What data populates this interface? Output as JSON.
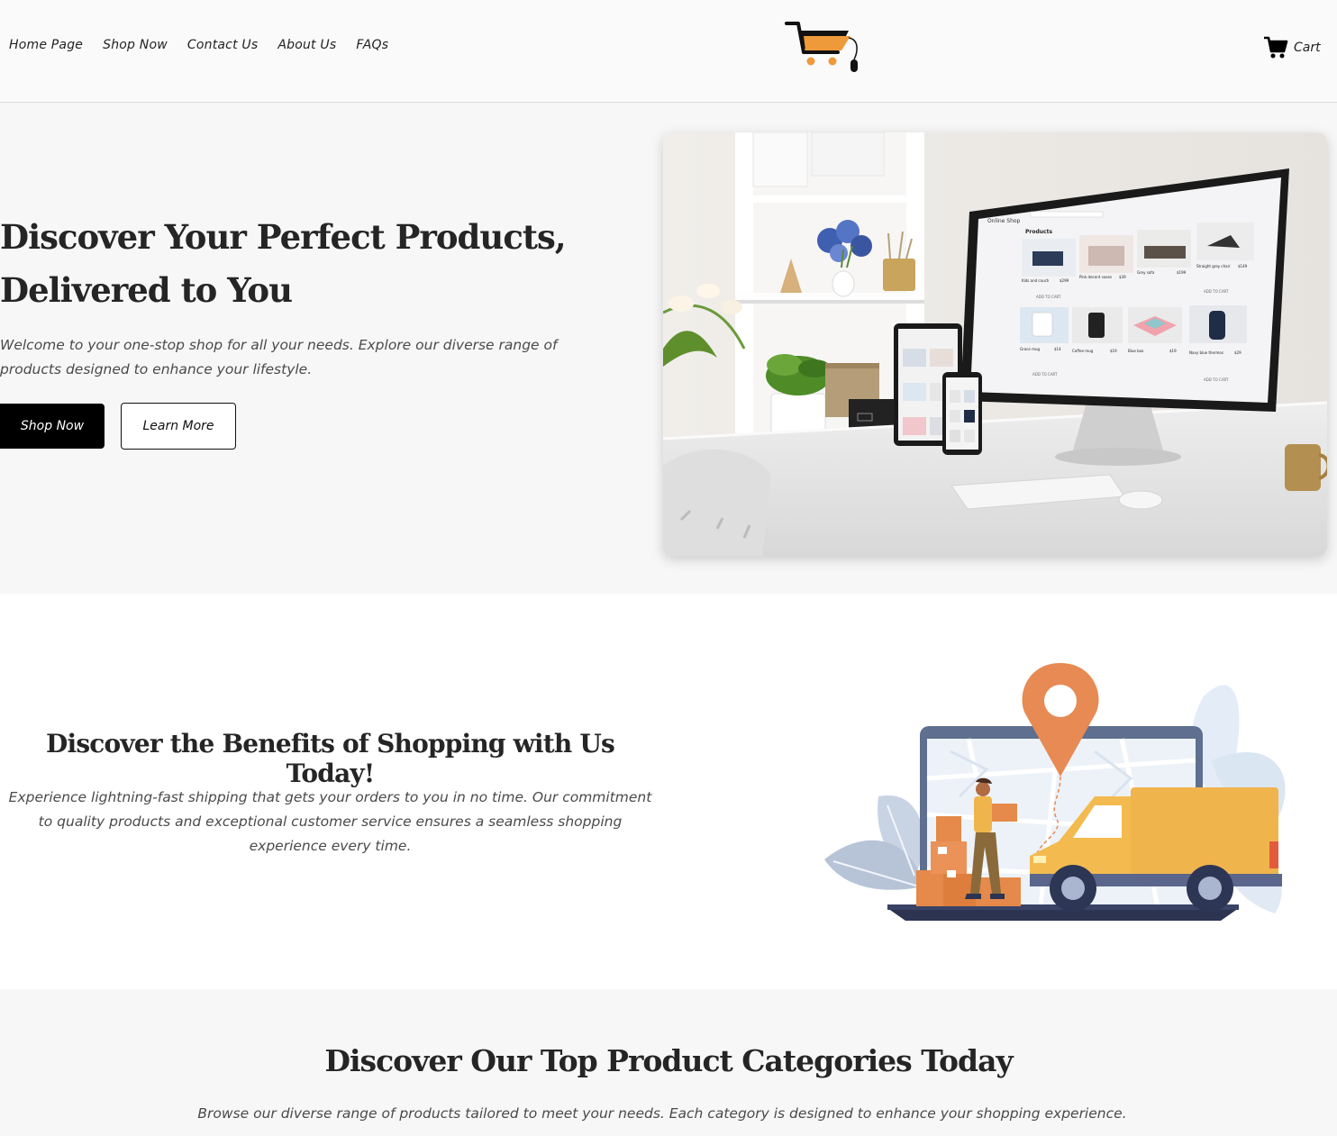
{
  "header": {
    "nav": [
      "Home Page",
      "Shop Now",
      "Contact Us",
      "About Us",
      "FAQs"
    ],
    "cart_label": "Cart",
    "logo_icon": "shopping-cart-mouse-logo",
    "brand_orange": "#ee9a3b"
  },
  "hero": {
    "title": "Discover Your Perfect Products, Delivered to You",
    "subtitle": "Welcome to your one-stop shop for all your needs. Explore our diverse range of products designed to enhance your lifestyle.",
    "primary_button": "Shop Now",
    "secondary_button": "Learn More"
  },
  "hero_screen": {
    "brand": "Online Shop",
    "heading": "Products",
    "products": [
      {
        "name": "Kids and couch",
        "price": "$299"
      },
      {
        "name": "Pink decent vases",
        "price": "$39"
      },
      {
        "name": "Grey sofa",
        "price": "$199"
      },
      {
        "name": "Straight grey chair",
        "price": "$149"
      },
      {
        "name": "Grace mug",
        "price": "$14"
      },
      {
        "name": "Coffee mug",
        "price": "$19"
      },
      {
        "name": "Blue box",
        "price": "$19"
      },
      {
        "name": "Navy blue thermos",
        "price": "$29"
      }
    ],
    "add_to_cart": "ADD TO CART"
  },
  "benefits": {
    "title": "Discover the Benefits of Shopping with Us Today!",
    "text": "Experience lightning-fast shipping that gets your orders to you in no time. Our commitment to quality products and exceptional customer service ensures a seamless shopping experience every time."
  },
  "categories": {
    "title": "Discover Our Top Product Categories Today",
    "text": "Browse our diverse range of products tailored to meet your needs. Each category is designed to enhance your shopping experience."
  }
}
